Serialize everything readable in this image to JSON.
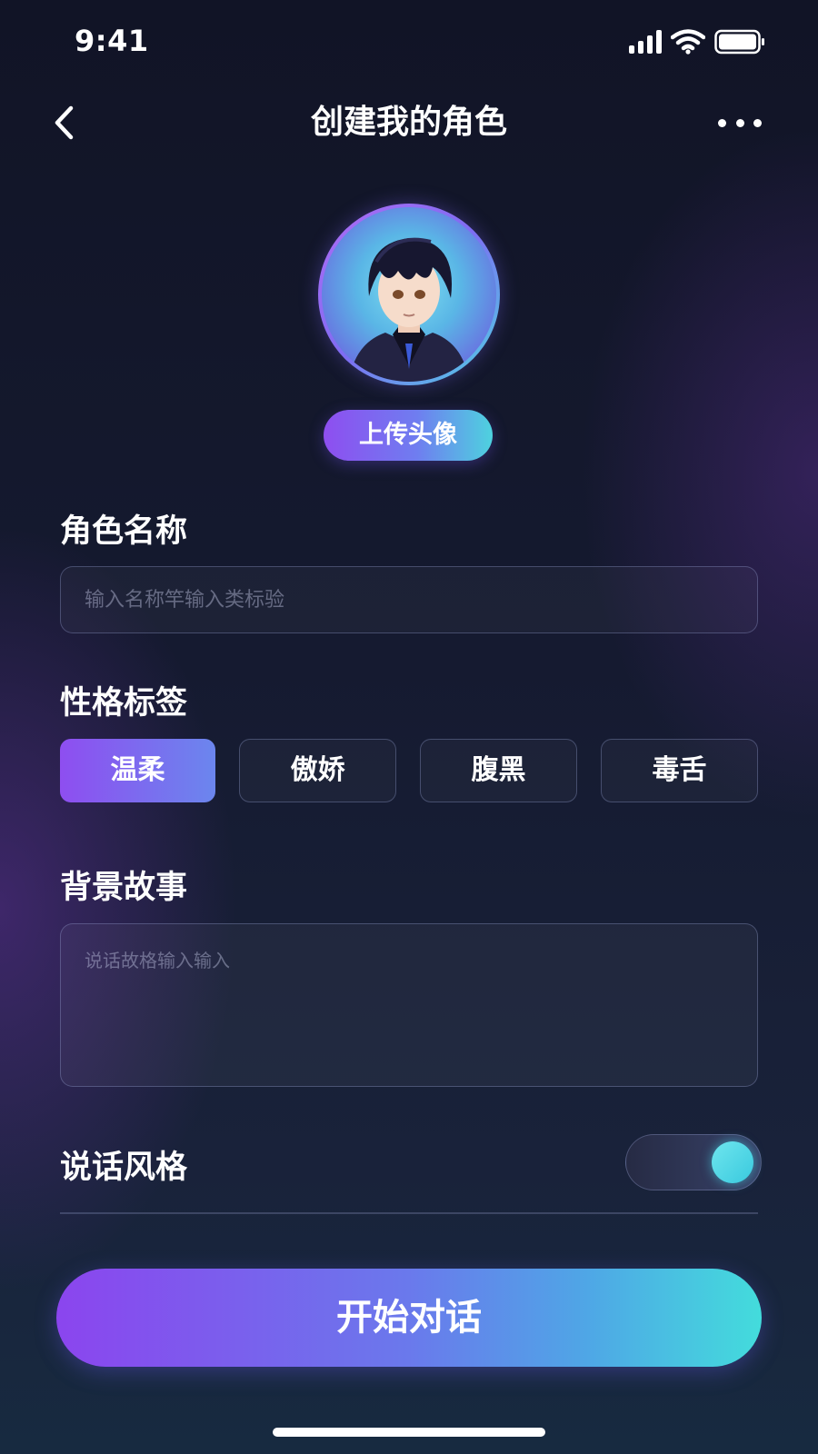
{
  "status_bar": {
    "time": "9:41"
  },
  "nav": {
    "title": "创建我的角色"
  },
  "avatar": {
    "upload_label": "上传头像"
  },
  "form": {
    "name_label": "角色名称",
    "name_placeholder": "输入名称竿输入类标验",
    "tags_label": "性格标签",
    "tags": [
      {
        "label": "温柔",
        "selected": true
      },
      {
        "label": "傲娇",
        "selected": false
      },
      {
        "label": "腹黑",
        "selected": false
      },
      {
        "label": "毒舌",
        "selected": false
      }
    ],
    "background_label": "背景故事",
    "background_placeholder": "说话故格输入输入",
    "style_label": "说话风格",
    "style_toggle_on": true
  },
  "primary_action": {
    "label": "开始对话"
  },
  "colors": {
    "accent_purple": "#8e4ef0",
    "accent_cyan": "#43dcdc",
    "background": "#151a30"
  },
  "icons": [
    "back-arrow-icon",
    "more-dots-icon",
    "signal-icon",
    "wifi-icon",
    "battery-icon"
  ]
}
